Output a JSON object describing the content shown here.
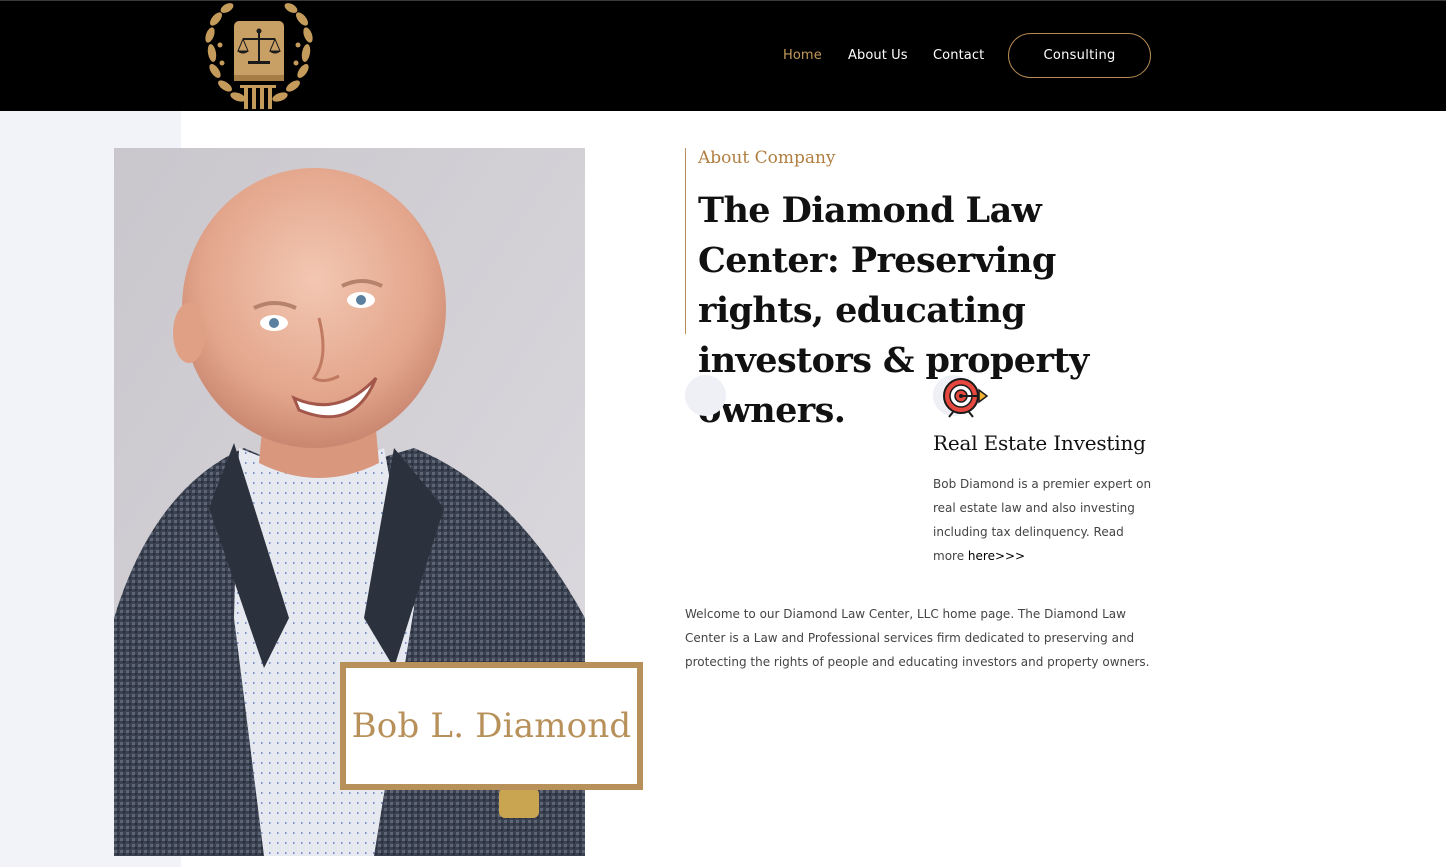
{
  "header": {
    "nav": [
      {
        "label": "Home",
        "active": true
      },
      {
        "label": "About Us",
        "active": false
      },
      {
        "label": "Contact",
        "active": false
      }
    ],
    "cta_label": "Consulting"
  },
  "colors": {
    "gold": "#b8905a",
    "header_bg": "#000000",
    "pale_bg": "#f1f3f8"
  },
  "about": {
    "eyebrow": "About Company",
    "title": "The Diamond Law Center: Preserving rights, educating investors & property owners."
  },
  "portrait": {
    "name": "Bob L. Diamond"
  },
  "feature": {
    "icon": "target-icon",
    "title": "Real Estate Investing",
    "text": "Bob Diamond is a premier expert on real estate law and also investing including tax delinquency. Read more ",
    "link_label": "here>>>"
  },
  "welcome_text": "Welcome to our Diamond Law Center, LLC home page. The Diamond Law Center is a Law and Professional services firm dedicated to preserving and protecting the rights of people and educating investors and property owners."
}
